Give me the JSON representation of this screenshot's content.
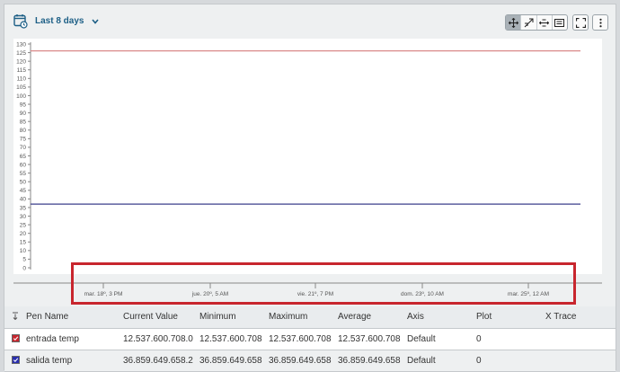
{
  "toolbar": {
    "range_label": "Last 8 days",
    "tools": [
      {
        "name": "pan-tool",
        "icon": "pan-icon",
        "active": true
      },
      {
        "name": "zoom-tool",
        "icon": "zoom-select-icon",
        "active": false
      },
      {
        "name": "x-zoom-tool",
        "icon": "x-zoom-icon",
        "active": false
      },
      {
        "name": "annotation-tool",
        "icon": "annotation-icon",
        "active": false
      }
    ],
    "extra_buttons": [
      "fullscreen-icon",
      "more-vert-icon"
    ]
  },
  "chart_data": {
    "type": "line",
    "ylim": [
      0,
      130
    ],
    "yticks": [
      0,
      5,
      10,
      15,
      20,
      25,
      30,
      35,
      40,
      45,
      50,
      55,
      60,
      65,
      70,
      75,
      80,
      85,
      90,
      95,
      100,
      105,
      110,
      115,
      120,
      125,
      130
    ],
    "x_tick_labels": [
      "mar. 18º, 3 PM",
      "jue. 20º, 5 AM",
      "vie. 21º, 7 PM",
      "dom. 23º, 10 AM",
      "mar. 25º, 12 AM"
    ],
    "grid": false,
    "series": [
      {
        "name": "entrada temp",
        "color": "#d9898a",
        "values": [
          126,
          126
        ]
      },
      {
        "name": "salida temp",
        "color": "#3b3f8c",
        "values": [
          37,
          37
        ]
      }
    ]
  },
  "table": {
    "columns": [
      "Pen Name",
      "Current Value",
      "Minimum",
      "Maximum",
      "Average",
      "Axis",
      "Plot",
      "X Trace"
    ],
    "rows": [
      {
        "color": "#c8262e",
        "name": "entrada temp",
        "current": "12.537.600.708.0",
        "min": "12.537.600.708",
        "max": "12.537.600.708",
        "avg": "12.537.600.708",
        "axis": "Default",
        "plot": "0",
        "xtrace": ""
      },
      {
        "color": "#2a2fae",
        "name": "salida temp",
        "current": "36.859.649.658.2",
        "min": "36.859.649.658",
        "max": "36.859.649.658",
        "avg": "36.859.649.658",
        "axis": "Default",
        "plot": "0",
        "xtrace": ""
      }
    ]
  }
}
